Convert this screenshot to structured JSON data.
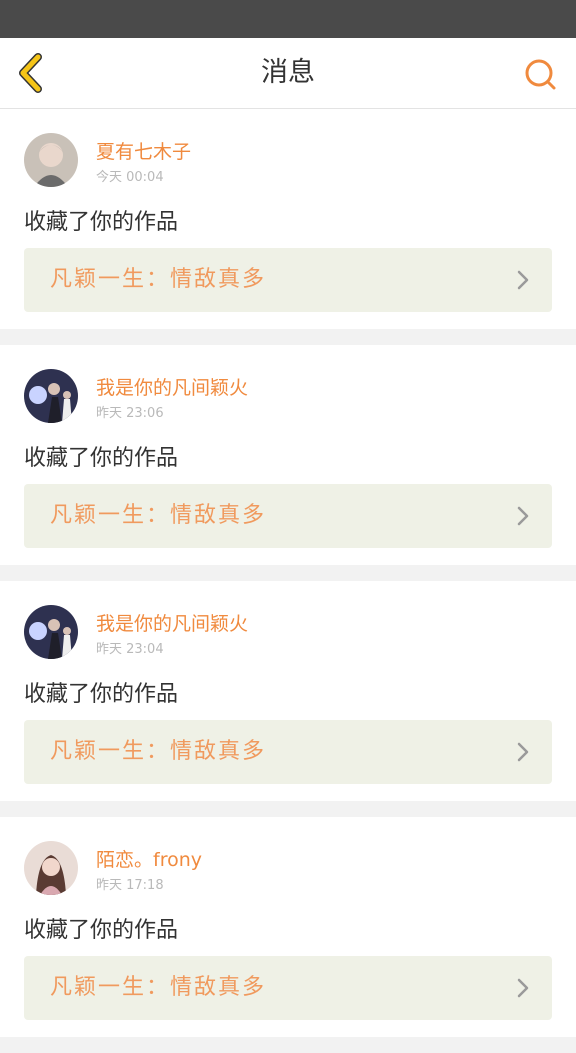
{
  "header": {
    "title": "消息",
    "back_icon": "chevron-left-icon",
    "search_icon": "search-icon",
    "accent": "#f5c518",
    "search_color": "#f08a3e"
  },
  "messages": [
    {
      "username": "夏有七木子",
      "time": "今天 00:04",
      "action": "收藏了你的作品",
      "work_title": "凡颖一生：情敌真多"
    },
    {
      "username": "我是你的凡间颖火",
      "time": "昨天 23:06",
      "action": "收藏了你的作品",
      "work_title": "凡颖一生：情敌真多"
    },
    {
      "username": "我是你的凡间颖火",
      "time": "昨天 23:04",
      "action": "收藏了你的作品",
      "work_title": "凡颖一生：情敌真多"
    },
    {
      "username": "陌恋。frony",
      "time": "昨天 17:18",
      "action": "收藏了你的作品",
      "work_title": "凡颖一生：情敌真多"
    }
  ]
}
